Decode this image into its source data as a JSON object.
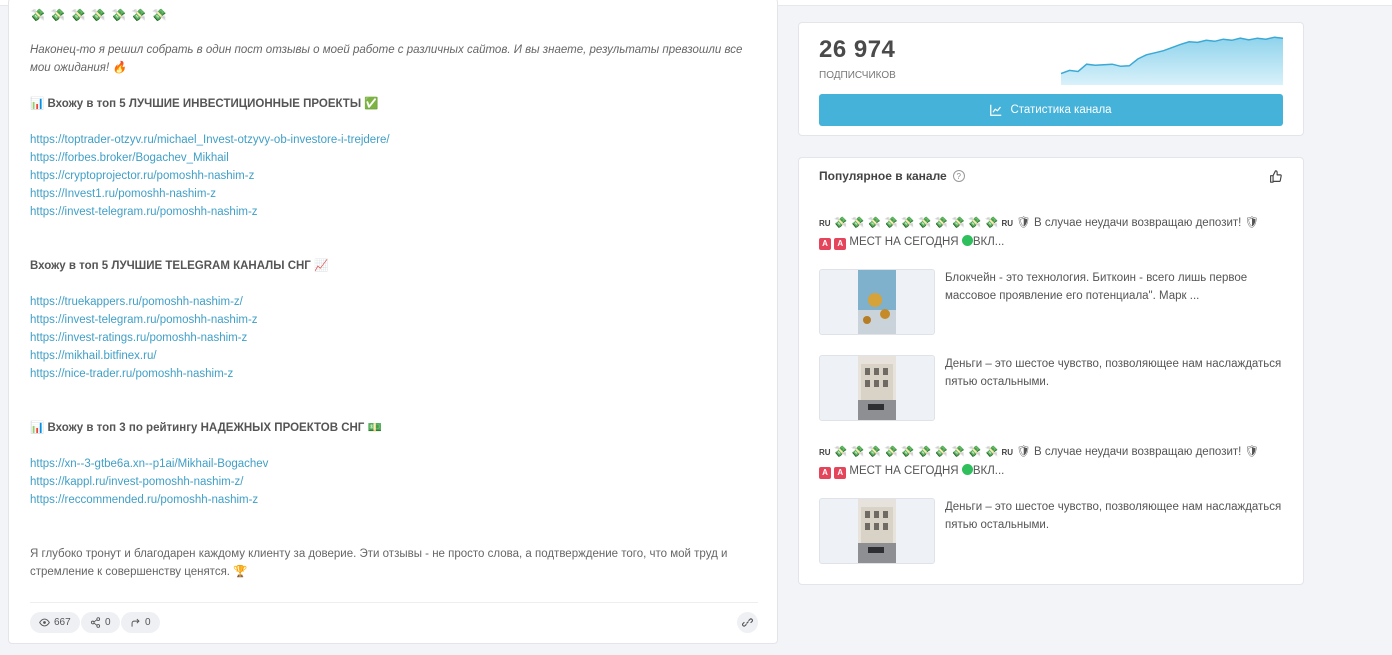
{
  "post": {
    "emoji_row": "💸 💸 💸 💸 💸 💸 💸",
    "intro": "Наконец-то я решил собрать в один пост отзывы о моей работе с различных сайтов. И вы знаете, результаты превзошли все мои ожидания! 🔥",
    "section1": {
      "heading": "📊 Вхожу в топ 5 ЛУЧШИЕ ИНВЕСТИЦИОННЫЕ ПРОЕКТЫ ✅",
      "links": [
        "https://toptrader-otzyv.ru/michael_Invest-otzyvy-ob-investore-i-trejdere/",
        "https://forbes.broker/Bogachev_Mikhail",
        "https://cryptoprojector.ru/pomoshh-nashim-z",
        "https://Invest1.ru/pomoshh-nashim-z",
        "https://invest-telegram.ru/pomoshh-nashim-z"
      ]
    },
    "section2": {
      "heading": "Вхожу в топ 5 ЛУЧШИЕ TELEGRAM КАНАЛЫ СНГ 📈",
      "links": [
        "https://truekappers.ru/pomoshh-nashim-z/",
        "https://invest-telegram.ru/pomoshh-nashim-z",
        "https://invest-ratings.ru/pomoshh-nashim-z",
        "https://mikhail.bitfinex.ru/",
        "https://nice-trader.ru/pomoshh-nashim-z"
      ]
    },
    "section3": {
      "heading": "📊 Вхожу в топ 3 по рейтингу НАДЕЖНЫХ ПРОЕКТОВ СНГ 💵",
      "links": [
        "https://xn--3-gtbe6a.xn--p1ai/Mikhail-Bogachev",
        "https://kappl.ru/invest-pomoshh-nashim-z/",
        "https://reccommended.ru/pomoshh-nashim-z"
      ]
    },
    "outro": "Я глубоко тронут и благодарен каждому клиенту за доверие. Эти отзывы - не просто слова, а подтверждение того, что мой труд и стремление к совершенству ценятся. 🏆",
    "footer": {
      "views": "667",
      "shares": "0",
      "forwards": "0"
    }
  },
  "stats": {
    "subscribers": "26 974",
    "subscribers_label": "подписчиков",
    "button_label": "Статистика канала",
    "sparkline": [
      0.22,
      0.28,
      0.26,
      0.4,
      0.38,
      0.39,
      0.4,
      0.36,
      0.37,
      0.5,
      0.58,
      0.62,
      0.66,
      0.72,
      0.78,
      0.83,
      0.82,
      0.86,
      0.84,
      0.88,
      0.86,
      0.9,
      0.87,
      0.9,
      0.88,
      0.92,
      0.9
    ]
  },
  "popular": {
    "title": "Популярное в канале",
    "items": [
      {
        "tag_left": "RU",
        "money": "💸 💸 💸 💸 💸 💸 💸 💸 💸 💸",
        "tag_right": "RU",
        "text": "🛡 В случае неудачи возвращаю депозит! 🛡",
        "line2": "МЕСТ НА СЕГОДНЯ",
        "badge": "A",
        "vkl": "ВКЛ..."
      },
      {
        "text": "Блокчейн - это технология. Биткоин - всего лишь первое массовое проявление его потенциала\". Марк ..."
      },
      {
        "text": "Деньги – это шестое чувство, позволяющее нам наслаждаться пятью остальными."
      },
      {
        "tag_left": "RU",
        "money": "💸 💸 💸 💸 💸 💸 💸 💸 💸 💸",
        "tag_right": "RU",
        "text": "🛡 В случае неудачи возвращаю депозит! 🛡",
        "line2": "МЕСТ НА СЕГОДНЯ",
        "badge": "A",
        "vkl": "ВКЛ..."
      },
      {
        "text": "Деньги – это шестое чувство, позволяющее нам наслаждаться пятью остальными."
      }
    ]
  },
  "colors": {
    "accent": "#44b2d9",
    "link": "#3f9fc7",
    "badge_red": "#e4455b",
    "dot_green": "#2fbf5c"
  }
}
